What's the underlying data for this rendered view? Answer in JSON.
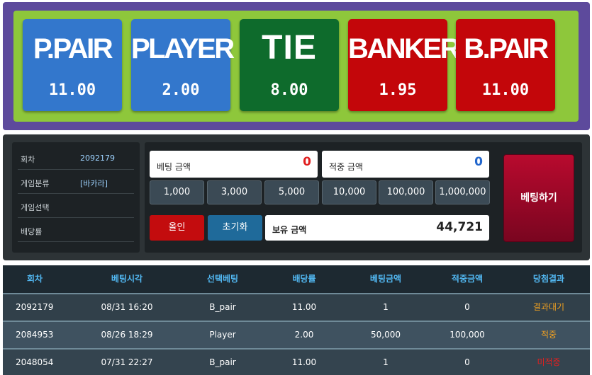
{
  "bets": [
    {
      "name": "P.PAIR",
      "odds": "11.00",
      "color": "#3377cc"
    },
    {
      "name": "PLAYER",
      "odds": "2.00",
      "color": "#3377cc"
    },
    {
      "name": "TIE",
      "odds": "8.00",
      "color": "#0e6b2c"
    },
    {
      "name": "BANKER",
      "odds": "1.95",
      "color": "#c3060a"
    },
    {
      "name": "B.PAIR",
      "odds": "11.00",
      "color": "#c3060a"
    }
  ],
  "info": {
    "round_label": "회차",
    "round_value": "2092179",
    "category_label": "게임분류",
    "category_value": "[바카라]",
    "selection_label": "게임선택",
    "selection_value": "",
    "odds_label": "배당률",
    "odds_value": ""
  },
  "bet_form": {
    "bet_amount_label": "베팅 금액",
    "bet_amount_value": "0",
    "win_amount_label": "적중 금액",
    "win_amount_value": "0",
    "chips": [
      "1,000",
      "3,000",
      "5,000",
      "10,000",
      "100,000",
      "1,000,000"
    ],
    "all_in_label": "올인",
    "reset_label": "초기화",
    "balance_label": "보유 금액",
    "balance_value": "44,721",
    "place_bet_label": "베팅하기"
  },
  "history": {
    "headers": [
      "회차",
      "베팅시각",
      "선택베팅",
      "배당률",
      "베팅금액",
      "적중금액",
      "당첨결과"
    ],
    "rows": [
      {
        "round": "2092179",
        "time": "08/31 16:20",
        "pick": "B_pair",
        "odds": "11.00",
        "bet": "1",
        "win": "0",
        "result": "결과대기",
        "result_color": "#f0a020"
      },
      {
        "round": "2084953",
        "time": "08/26 18:29",
        "pick": "Player",
        "odds": "2.00",
        "bet": "50,000",
        "win": "100,000",
        "result": "적중",
        "result_color": "#f0a020"
      },
      {
        "round": "2048054",
        "time": "07/31 22:27",
        "pick": "B_pair",
        "odds": "11.00",
        "bet": "1",
        "win": "0",
        "result": "미적중",
        "result_color": "#e02020"
      }
    ]
  },
  "colors": {
    "frame": "#5d4a9c",
    "board": "#8ec73b",
    "value_red": "#e02020",
    "value_blue": "#2266cc",
    "header_text": "#52b8f2"
  }
}
